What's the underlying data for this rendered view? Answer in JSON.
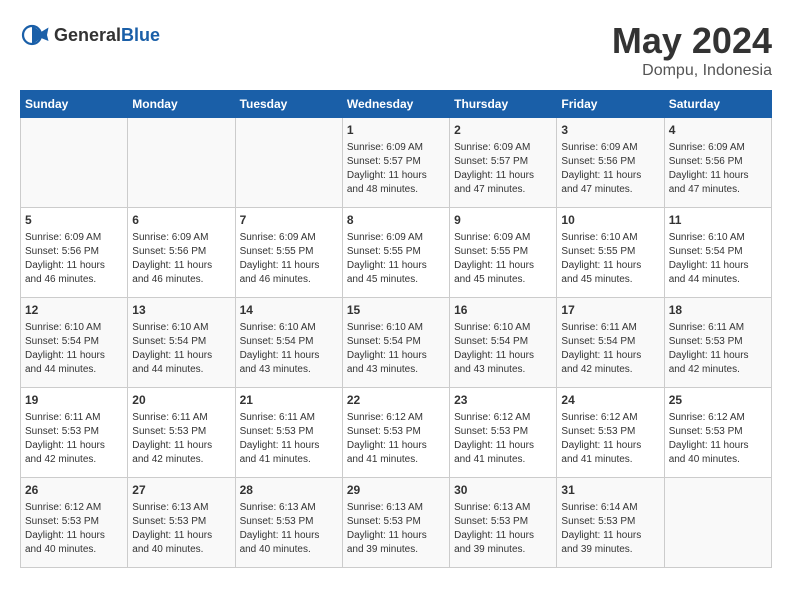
{
  "header": {
    "logo_general": "General",
    "logo_blue": "Blue",
    "month": "May 2024",
    "location": "Dompu, Indonesia"
  },
  "weekdays": [
    "Sunday",
    "Monday",
    "Tuesday",
    "Wednesday",
    "Thursday",
    "Friday",
    "Saturday"
  ],
  "weeks": [
    [
      {
        "day": "",
        "info": ""
      },
      {
        "day": "",
        "info": ""
      },
      {
        "day": "",
        "info": ""
      },
      {
        "day": "1",
        "info": "Sunrise: 6:09 AM\nSunset: 5:57 PM\nDaylight: 11 hours\nand 48 minutes."
      },
      {
        "day": "2",
        "info": "Sunrise: 6:09 AM\nSunset: 5:57 PM\nDaylight: 11 hours\nand 47 minutes."
      },
      {
        "day": "3",
        "info": "Sunrise: 6:09 AM\nSunset: 5:56 PM\nDaylight: 11 hours\nand 47 minutes."
      },
      {
        "day": "4",
        "info": "Sunrise: 6:09 AM\nSunset: 5:56 PM\nDaylight: 11 hours\nand 47 minutes."
      }
    ],
    [
      {
        "day": "5",
        "info": "Sunrise: 6:09 AM\nSunset: 5:56 PM\nDaylight: 11 hours\nand 46 minutes."
      },
      {
        "day": "6",
        "info": "Sunrise: 6:09 AM\nSunset: 5:56 PM\nDaylight: 11 hours\nand 46 minutes."
      },
      {
        "day": "7",
        "info": "Sunrise: 6:09 AM\nSunset: 5:55 PM\nDaylight: 11 hours\nand 46 minutes."
      },
      {
        "day": "8",
        "info": "Sunrise: 6:09 AM\nSunset: 5:55 PM\nDaylight: 11 hours\nand 45 minutes."
      },
      {
        "day": "9",
        "info": "Sunrise: 6:09 AM\nSunset: 5:55 PM\nDaylight: 11 hours\nand 45 minutes."
      },
      {
        "day": "10",
        "info": "Sunrise: 6:10 AM\nSunset: 5:55 PM\nDaylight: 11 hours\nand 45 minutes."
      },
      {
        "day": "11",
        "info": "Sunrise: 6:10 AM\nSunset: 5:54 PM\nDaylight: 11 hours\nand 44 minutes."
      }
    ],
    [
      {
        "day": "12",
        "info": "Sunrise: 6:10 AM\nSunset: 5:54 PM\nDaylight: 11 hours\nand 44 minutes."
      },
      {
        "day": "13",
        "info": "Sunrise: 6:10 AM\nSunset: 5:54 PM\nDaylight: 11 hours\nand 44 minutes."
      },
      {
        "day": "14",
        "info": "Sunrise: 6:10 AM\nSunset: 5:54 PM\nDaylight: 11 hours\nand 43 minutes."
      },
      {
        "day": "15",
        "info": "Sunrise: 6:10 AM\nSunset: 5:54 PM\nDaylight: 11 hours\nand 43 minutes."
      },
      {
        "day": "16",
        "info": "Sunrise: 6:10 AM\nSunset: 5:54 PM\nDaylight: 11 hours\nand 43 minutes."
      },
      {
        "day": "17",
        "info": "Sunrise: 6:11 AM\nSunset: 5:54 PM\nDaylight: 11 hours\nand 42 minutes."
      },
      {
        "day": "18",
        "info": "Sunrise: 6:11 AM\nSunset: 5:53 PM\nDaylight: 11 hours\nand 42 minutes."
      }
    ],
    [
      {
        "day": "19",
        "info": "Sunrise: 6:11 AM\nSunset: 5:53 PM\nDaylight: 11 hours\nand 42 minutes."
      },
      {
        "day": "20",
        "info": "Sunrise: 6:11 AM\nSunset: 5:53 PM\nDaylight: 11 hours\nand 42 minutes."
      },
      {
        "day": "21",
        "info": "Sunrise: 6:11 AM\nSunset: 5:53 PM\nDaylight: 11 hours\nand 41 minutes."
      },
      {
        "day": "22",
        "info": "Sunrise: 6:12 AM\nSunset: 5:53 PM\nDaylight: 11 hours\nand 41 minutes."
      },
      {
        "day": "23",
        "info": "Sunrise: 6:12 AM\nSunset: 5:53 PM\nDaylight: 11 hours\nand 41 minutes."
      },
      {
        "day": "24",
        "info": "Sunrise: 6:12 AM\nSunset: 5:53 PM\nDaylight: 11 hours\nand 41 minutes."
      },
      {
        "day": "25",
        "info": "Sunrise: 6:12 AM\nSunset: 5:53 PM\nDaylight: 11 hours\nand 40 minutes."
      }
    ],
    [
      {
        "day": "26",
        "info": "Sunrise: 6:12 AM\nSunset: 5:53 PM\nDaylight: 11 hours\nand 40 minutes."
      },
      {
        "day": "27",
        "info": "Sunrise: 6:13 AM\nSunset: 5:53 PM\nDaylight: 11 hours\nand 40 minutes."
      },
      {
        "day": "28",
        "info": "Sunrise: 6:13 AM\nSunset: 5:53 PM\nDaylight: 11 hours\nand 40 minutes."
      },
      {
        "day": "29",
        "info": "Sunrise: 6:13 AM\nSunset: 5:53 PM\nDaylight: 11 hours\nand 39 minutes."
      },
      {
        "day": "30",
        "info": "Sunrise: 6:13 AM\nSunset: 5:53 PM\nDaylight: 11 hours\nand 39 minutes."
      },
      {
        "day": "31",
        "info": "Sunrise: 6:14 AM\nSunset: 5:53 PM\nDaylight: 11 hours\nand 39 minutes."
      },
      {
        "day": "",
        "info": ""
      }
    ]
  ]
}
